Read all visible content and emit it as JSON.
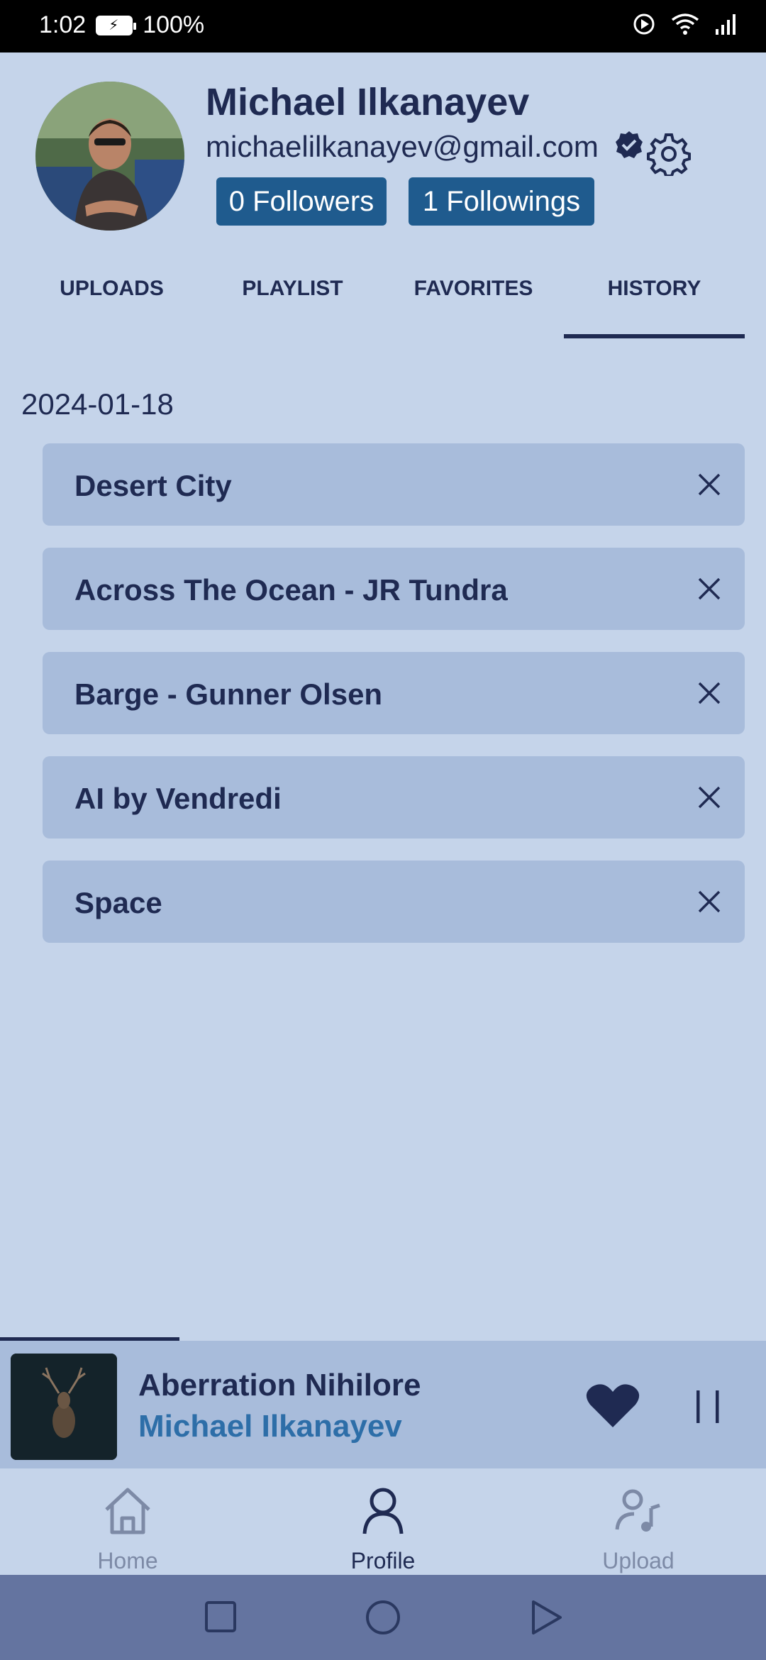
{
  "status_bar": {
    "time": "1:02",
    "battery": "100%"
  },
  "profile": {
    "name": "Michael Ilkanayev",
    "email": "michaelilkanayev@gmail.com",
    "followers_label": "0 Followers",
    "followings_label": "1 Followings"
  },
  "tabs": [
    {
      "label": "UPLOADS"
    },
    {
      "label": "PLAYLIST"
    },
    {
      "label": "FAVORITES"
    },
    {
      "label": "HISTORY"
    }
  ],
  "active_tab": "HISTORY",
  "history": {
    "date": "2024-01-18",
    "items": [
      {
        "title": "Desert City"
      },
      {
        "title": "Across The Ocean - JR Tundra"
      },
      {
        "title": "Barge - Gunner Olsen"
      },
      {
        "title": "AI by Vendredi"
      },
      {
        "title": "Space"
      }
    ]
  },
  "now_playing": {
    "title": "Aberration Nihilore",
    "artist": "Michael Ilkanayev",
    "progress": 0.234,
    "liked": true,
    "state": "playing"
  },
  "bottom_nav": [
    {
      "label": "Home",
      "icon": "home-icon"
    },
    {
      "label": "Profile",
      "icon": "profile-icon"
    },
    {
      "label": "Upload",
      "icon": "upload-music-icon"
    }
  ],
  "colors": {
    "background": "#c5d4ea",
    "card": "#a8bcdb",
    "primary_text": "#1f2a52",
    "accent": "#1f5b8e",
    "artist_link": "#2d6ea8",
    "system_nav": "#6474a0"
  }
}
